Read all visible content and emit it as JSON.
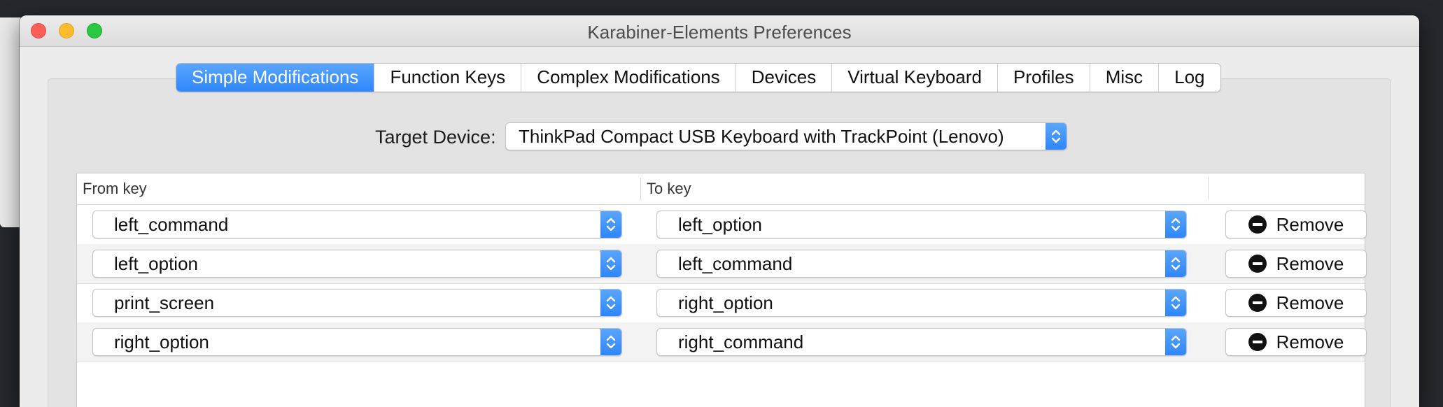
{
  "window": {
    "title": "Karabiner-Elements Preferences"
  },
  "tabs": [
    {
      "label": "Simple Modifications",
      "active": true
    },
    {
      "label": "Function Keys",
      "active": false
    },
    {
      "label": "Complex Modifications",
      "active": false
    },
    {
      "label": "Devices",
      "active": false
    },
    {
      "label": "Virtual Keyboard",
      "active": false
    },
    {
      "label": "Profiles",
      "active": false
    },
    {
      "label": "Misc",
      "active": false
    },
    {
      "label": "Log",
      "active": false
    }
  ],
  "target_device": {
    "label": "Target Device:",
    "value": "ThinkPad Compact USB Keyboard with TrackPoint (Lenovo)"
  },
  "table": {
    "headers": {
      "from": "From key",
      "to": "To key",
      "action": ""
    },
    "rows": [
      {
        "from": "left_command",
        "to": "left_option",
        "action": "Remove"
      },
      {
        "from": "left_option",
        "to": "left_command",
        "action": "Remove"
      },
      {
        "from": "print_screen",
        "to": "right_option",
        "action": "Remove"
      },
      {
        "from": "right_option",
        "to": "right_command",
        "action": "Remove"
      }
    ]
  },
  "colors": {
    "accent": "#2f86fb",
    "close": "#fc5f57",
    "minimize": "#fdbc2e",
    "maximize": "#28c840"
  },
  "icons": {
    "stepper": "chevron-up-down-icon",
    "remove": "minus-circle-icon"
  }
}
